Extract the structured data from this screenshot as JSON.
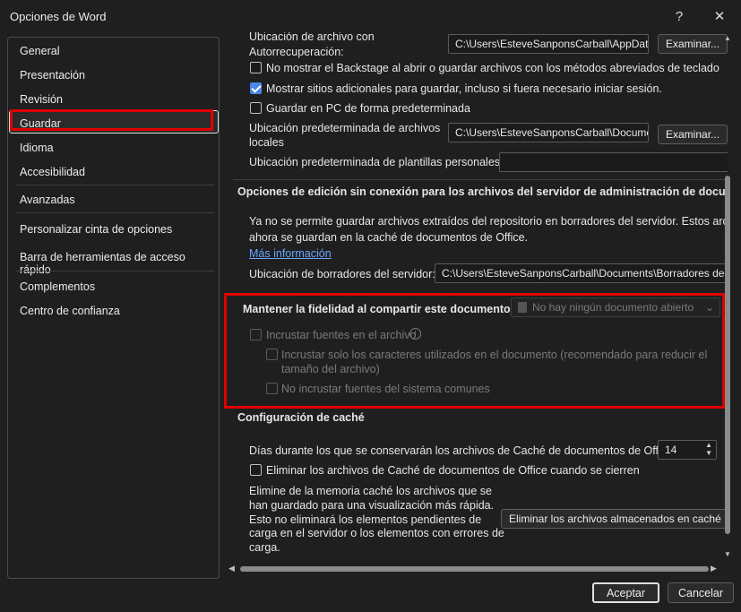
{
  "window": {
    "title": "Opciones de Word",
    "help_glyph": "?",
    "close_glyph": "✕"
  },
  "sidebar": {
    "items": [
      "General",
      "Presentación",
      "Revisión",
      "Guardar",
      "Idioma",
      "Accesibilidad",
      "Avanzadas",
      "Personalizar cinta de opciones",
      "Barra de herramientas de acceso rápido",
      "Complementos",
      "Centro de confianza"
    ],
    "selected": "Guardar"
  },
  "save": {
    "autorecover_label_1": "Ubicación de archivo con",
    "autorecover_label_2": "Autorrecuperación:",
    "autorecover_path": "C:\\Users\\EsteveSanponsCarball\\AppData",
    "browse_1": "Examinar...",
    "no_backstage_label": "No mostrar el Backstage al abrir o guardar archivos con los métodos abreviados de teclado",
    "no_backstage_checked": false,
    "show_more_places_label": "Mostrar sitios adicionales para guardar, incluso si fuera necesario iniciar sesión.",
    "show_more_places_checked": true,
    "save_pc_default_label": "Guardar en PC de forma predeterminada",
    "save_pc_default_checked": false,
    "default_local_label_1": "Ubicación predeterminada de archivos",
    "default_local_label_2": "locales",
    "default_local_path": "C:\\Users\\EsteveSanponsCarball\\Documents",
    "browse_2": "Examinar...",
    "templates_label": "Ubicación predeterminada de plantillas personales:",
    "templates_path": ""
  },
  "offline": {
    "heading": "Opciones de edición sin conexión para los archivos del servidor de administración de documentos",
    "desc_1": "Ya no se permite guardar archivos extraídos del repositorio en borradores del servidor. Estos archivos",
    "desc_2": "ahora se guardan en la caché de documentos de Office.",
    "more_info": "Más información",
    "drafts_label": "Ubicación de borradores del servidor:",
    "drafts_path": "C:\\Users\\EsteveSanponsCarball\\Documents\\Borradores de"
  },
  "fidelity": {
    "heading": "Mantener la fidelidad al compartir este documento:",
    "doc_select": "No hay ningún documento abierto",
    "embed_fonts_label": "Incrustar fuentes en el archivo",
    "embed_used_label_1": "Incrustar solo los caracteres utilizados en el documento (recomendado para reducir el",
    "embed_used_label_2": "tamaño del archivo)",
    "no_common_label": "No incrustar fuentes del sistema comunes",
    "info_glyph": "i"
  },
  "cache": {
    "heading": "Configuración de caché",
    "days_label": "Días durante los que se conservarán los archivos de Caché de documentos de Office:",
    "days_value": "14",
    "delete_on_close_label": "Eliminar los archivos de Caché de documentos de Office cuando se cierren",
    "delete_on_close_checked": false,
    "desc_1": "Elimine de la memoria caché los archivos que se",
    "desc_2": "han guardado para una visualización más rápida.",
    "desc_3": "Esto no eliminará los elementos pendientes de",
    "desc_4": "carga en el servidor o los elementos con errores de",
    "desc_5": "carga.",
    "delete_button": "Eliminar los archivos almacenados en caché"
  },
  "footer": {
    "ok": "Aceptar",
    "cancel": "Cancelar"
  },
  "colors": {
    "accent": "#4a86e8",
    "highlight": "#e00000",
    "background": "#1f1f1f"
  }
}
